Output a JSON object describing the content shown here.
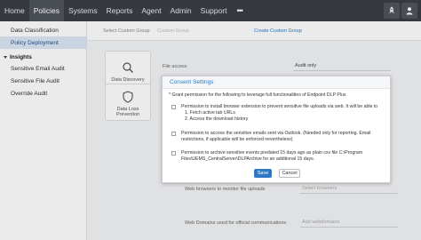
{
  "nav": {
    "items": [
      {
        "label": "Home",
        "active": false
      },
      {
        "label": "Policies",
        "active": true
      },
      {
        "label": "Systems",
        "active": false
      },
      {
        "label": "Reports",
        "active": false
      },
      {
        "label": "Agent",
        "active": false
      },
      {
        "label": "Admin",
        "active": false
      },
      {
        "label": "Support",
        "active": false
      }
    ],
    "more": "•••"
  },
  "sidebar": {
    "items_top": [
      {
        "label": "Data Classification",
        "active": false
      },
      {
        "label": "Policy Deployment",
        "active": true
      }
    ],
    "group_label": "Insights",
    "group_items": [
      {
        "label": "Sensitive Email Audit"
      },
      {
        "label": "Sensitive File Audit"
      },
      {
        "label": "Override Audit"
      }
    ]
  },
  "topbar": {
    "select_group_label": "Select Custom Group",
    "custom_group_placeholder": "Custom Group",
    "create_custom_group_link": "Create Custom Group"
  },
  "tiles": {
    "discovery": "Data Discovery",
    "dlp_line1": "Data Loss",
    "dlp_line2": "Prevention"
  },
  "form": {
    "file_access_label": "File access",
    "file_access_value": "Audit only",
    "web_browsers_label": "Web browsers to monitor file uploads",
    "web_browsers_placeholder": "Select browsers",
    "web_domains_label": "Web Domains used for official communications",
    "web_domains_placeholder": "Add webdomains"
  },
  "modal": {
    "title": "Consent Settings",
    "intro": "* Grant permission for the following to leverage full functionalities of Endpoint DLP Plus",
    "option1": {
      "text": "Permission to install browser extension to prevent sensitive file uploads via web. It will be able to",
      "sub1": "1. Fetch active tab URLs",
      "sub2": "2. Access the download history"
    },
    "option2": {
      "text": "Permission to access the sensitive emails sent via Outlook. (Needed only for reporting. Email restrictions, if applicable will be enforced nevertheless)"
    },
    "option3": {
      "text": "Permission to archive sensitive events predated 15 days ago as plain csv file C:\\Program Files\\UEMS_CentralServer\\DLPArchive for an additional 15 days."
    },
    "save_label": "Save",
    "cancel_label": "Cancel"
  },
  "colors": {
    "nav_bg": "#3b3f46",
    "accent": "#2f79c4",
    "sidebar_active_bg": "#dde8f5"
  }
}
